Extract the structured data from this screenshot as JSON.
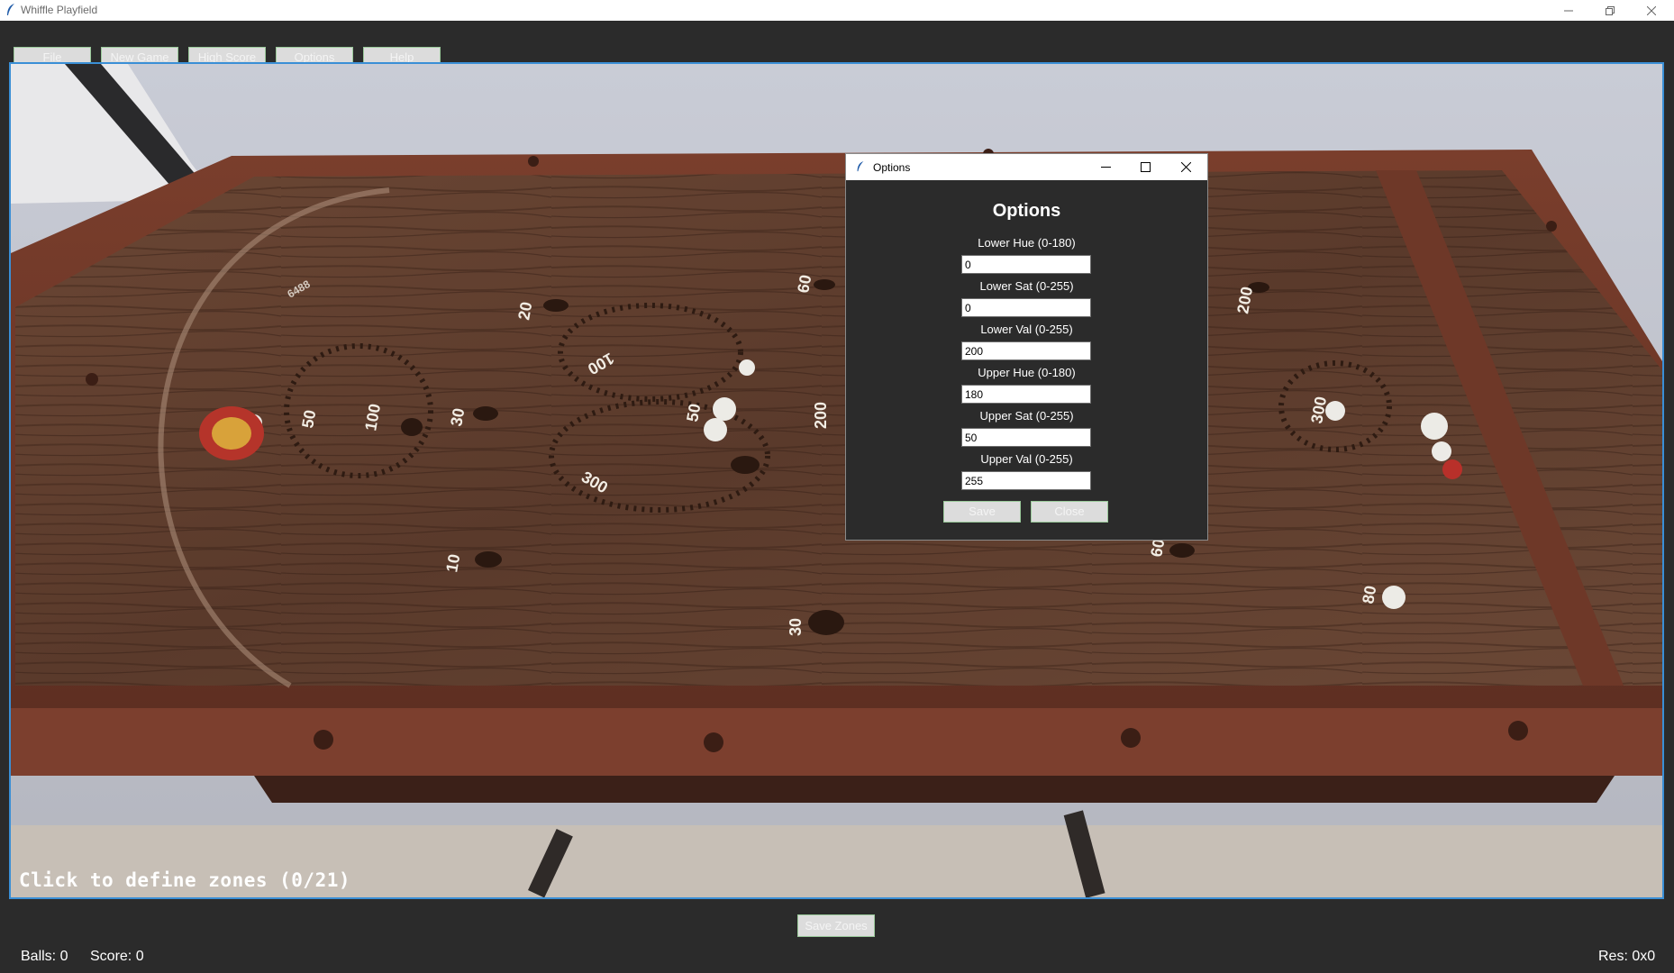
{
  "window": {
    "title": "Whiffle Playfield"
  },
  "menu": {
    "items": [
      {
        "label": "File"
      },
      {
        "label": "New Game"
      },
      {
        "label": "High Score"
      },
      {
        "label": "Options"
      },
      {
        "label": "Help"
      }
    ]
  },
  "canvas": {
    "hint": "Click to define zones (0/21)",
    "board_labels": [
      "6488",
      "20",
      "60",
      "100",
      "50",
      "100",
      "30",
      "200",
      "50",
      "200",
      "300",
      "10",
      "30",
      "60",
      "80",
      "100",
      "300"
    ]
  },
  "footer": {
    "save_zones_label": "Save Zones",
    "balls": "Balls: 0",
    "score": "Score: 0",
    "resolution": "Res: 0x0"
  },
  "dialog": {
    "title": "Options",
    "heading": "Options",
    "fields": [
      {
        "label": "Lower Hue (0-180)",
        "value": "0"
      },
      {
        "label": "Lower Sat (0-255)",
        "value": "0"
      },
      {
        "label": "Lower Val (0-255)",
        "value": "200"
      },
      {
        "label": "Upper Hue (0-180)",
        "value": "180"
      },
      {
        "label": "Upper Sat (0-255)",
        "value": "50"
      },
      {
        "label": "Upper Val (0-255)",
        "value": "255"
      }
    ],
    "save_label": "Save",
    "close_label": "Close"
  }
}
